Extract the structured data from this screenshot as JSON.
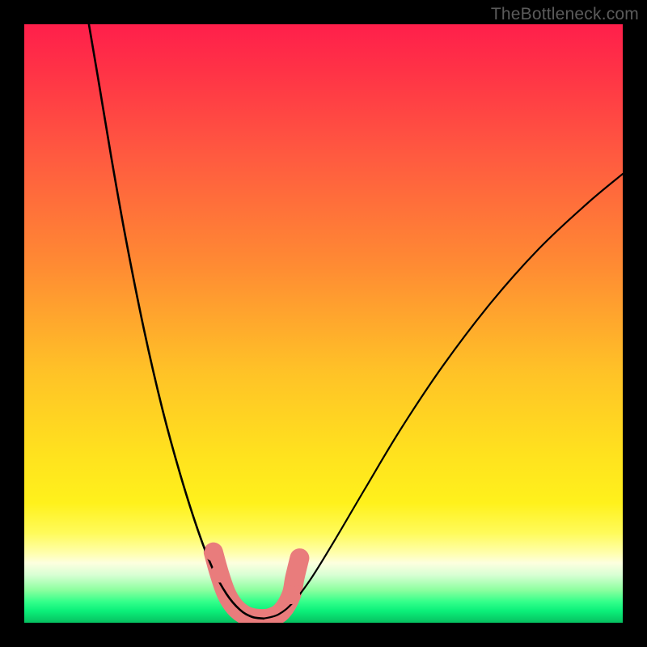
{
  "attribution": "TheBottleneck.com",
  "chart_data": {
    "type": "line",
    "title": "",
    "xlabel": "",
    "ylabel": "",
    "xlim": [
      0,
      100
    ],
    "ylim": [
      0,
      100
    ],
    "background_gradient_stops": [
      {
        "pos": 0,
        "color": "#ff1f4b"
      },
      {
        "pos": 22,
        "color": "#ff5a40"
      },
      {
        "pos": 58,
        "color": "#ffc227"
      },
      {
        "pos": 85,
        "color": "#fffb5a"
      },
      {
        "pos": 92,
        "color": "#d8ffd4"
      },
      {
        "pos": 100,
        "color": "#06c060"
      }
    ],
    "series": [
      {
        "name": "left-curve",
        "stroke": "#000000",
        "points": [
          {
            "x": 10.8,
            "y": 100.0
          },
          {
            "x": 12.5,
            "y": 90.0
          },
          {
            "x": 14.5,
            "y": 78.0
          },
          {
            "x": 17.0,
            "y": 64.0
          },
          {
            "x": 20.0,
            "y": 49.0
          },
          {
            "x": 23.0,
            "y": 36.0
          },
          {
            "x": 26.0,
            "y": 25.0
          },
          {
            "x": 29.0,
            "y": 15.5
          },
          {
            "x": 31.5,
            "y": 9.0
          },
          {
            "x": 33.8,
            "y": 4.8
          },
          {
            "x": 36.0,
            "y": 2.2
          },
          {
            "x": 38.0,
            "y": 1.0
          },
          {
            "x": 40.0,
            "y": 0.7
          }
        ]
      },
      {
        "name": "right-curve",
        "stroke": "#000000",
        "points": [
          {
            "x": 40.0,
            "y": 0.7
          },
          {
            "x": 42.5,
            "y": 1.4
          },
          {
            "x": 45.0,
            "y": 3.5
          },
          {
            "x": 48.0,
            "y": 7.5
          },
          {
            "x": 52.0,
            "y": 14.0
          },
          {
            "x": 57.0,
            "y": 22.5
          },
          {
            "x": 63.0,
            "y": 32.5
          },
          {
            "x": 70.0,
            "y": 43.0
          },
          {
            "x": 78.0,
            "y": 53.5
          },
          {
            "x": 86.0,
            "y": 62.5
          },
          {
            "x": 94.0,
            "y": 70.0
          },
          {
            "x": 100.0,
            "y": 75.0
          }
        ]
      },
      {
        "name": "trough-band",
        "stroke": "#e97c7c",
        "stroke_width_relative": 3.2,
        "points": [
          {
            "x": 31.6,
            "y": 11.8
          },
          {
            "x": 32.6,
            "y": 8.2
          },
          {
            "x": 33.8,
            "y": 4.8
          },
          {
            "x": 35.2,
            "y": 2.6
          },
          {
            "x": 37.0,
            "y": 1.2
          },
          {
            "x": 39.0,
            "y": 0.7
          },
          {
            "x": 41.0,
            "y": 0.8
          },
          {
            "x": 43.0,
            "y": 1.9
          },
          {
            "x": 44.6,
            "y": 4.6
          },
          {
            "x": 45.2,
            "y": 7.5
          },
          {
            "x": 46.0,
            "y": 10.8
          }
        ]
      },
      {
        "name": "markers",
        "type": "scatter",
        "color": "#e97c7c",
        "radius_relative": 1.5,
        "points": [
          {
            "x": 31.6,
            "y": 11.8
          },
          {
            "x": 32.6,
            "y": 8.2
          },
          {
            "x": 44.6,
            "y": 4.6
          },
          {
            "x": 45.2,
            "y": 7.5
          },
          {
            "x": 46.0,
            "y": 10.8
          }
        ]
      }
    ]
  }
}
